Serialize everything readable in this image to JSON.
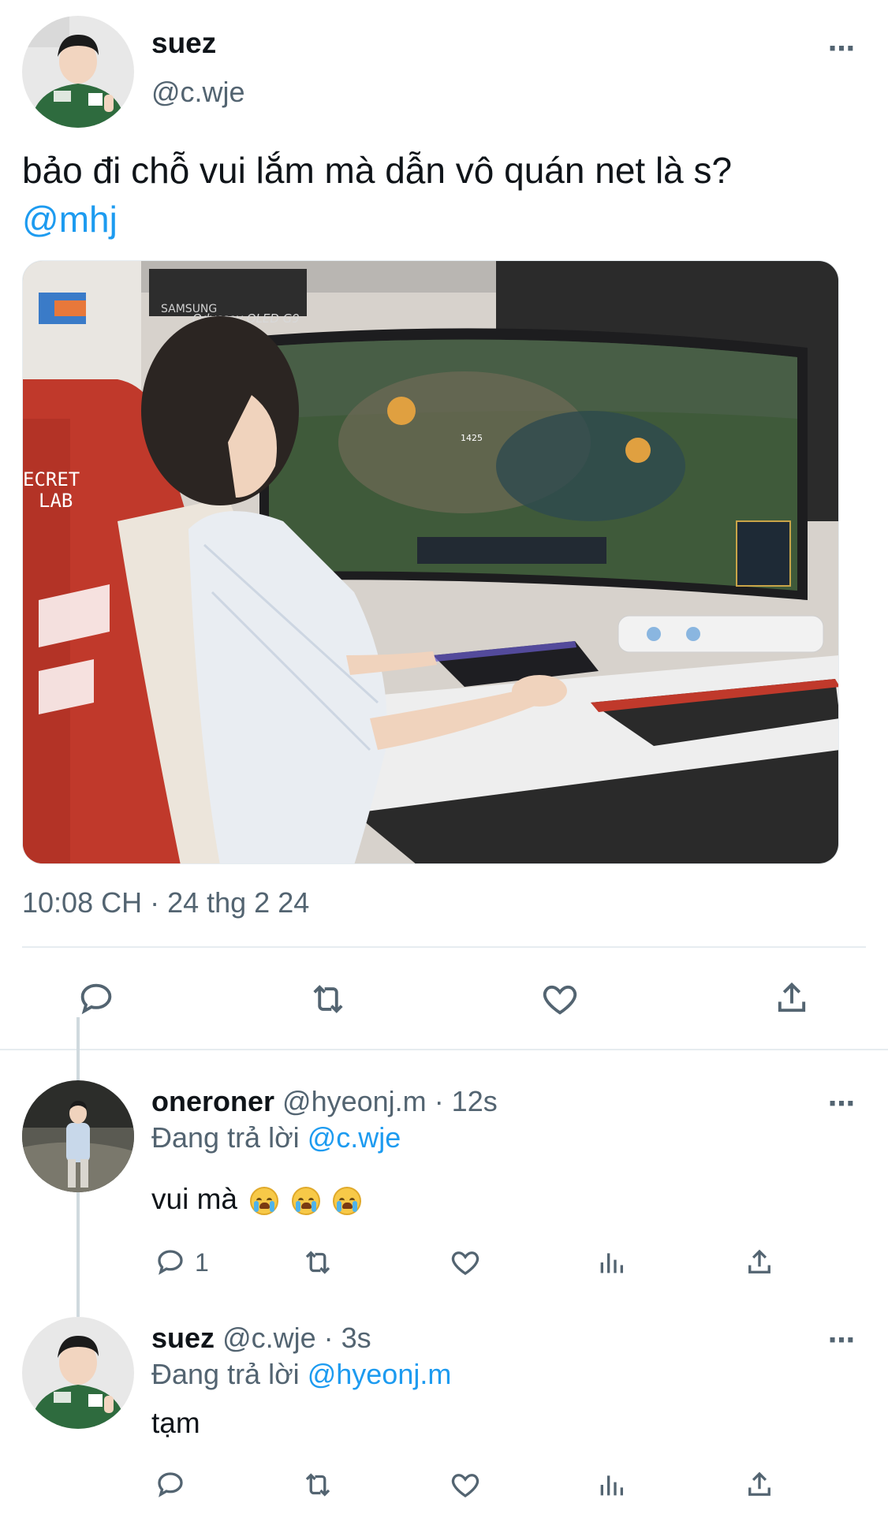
{
  "main_tweet": {
    "author_name": "suez",
    "author_handle": "@c.wje",
    "more_icon": "⋯",
    "text": "bảo đi chỗ vui lắm mà dẫn vô quán net là s?",
    "mention": "@mhj",
    "media": {
      "monitor_brand": "SAMSUNG",
      "monitor_model": "Odyssey OLED G9",
      "chair_brand_line1": "ECRET",
      "chair_brand_line2": "LAB",
      "hud_gold": "1425"
    },
    "timestamp": "10:08 CH · 24 thg 2 24",
    "actions": [
      "reply-icon",
      "retweet-icon",
      "like-icon",
      "share-icon"
    ]
  },
  "replies": [
    {
      "author_name": "oneroner",
      "author_handle": "@hyeonj.m",
      "time": "· 12s",
      "replying_prefix": "Đang trả lời",
      "replying_to": "@c.wje",
      "text": "vui mà",
      "emoji_count": 3,
      "reply_count": "1",
      "more_icon": "⋯"
    },
    {
      "author_name": "suez",
      "author_handle": "@c.wje",
      "time": "· 3s",
      "replying_prefix": "Đang trả lời",
      "replying_to": "@hyeonj.m",
      "text": "tạm",
      "more_icon": "⋯"
    }
  ],
  "colors": {
    "accent": "#1d9bf0",
    "secondary_text": "#536471",
    "divider": "#e6ecf0"
  }
}
